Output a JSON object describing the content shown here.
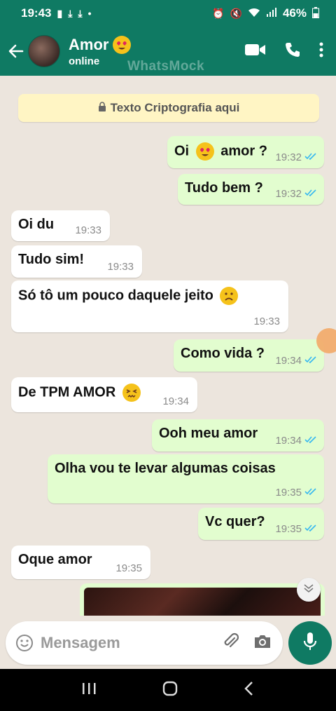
{
  "status_bar": {
    "time": "19:43",
    "battery": "46%"
  },
  "header": {
    "contact_name": "Amor",
    "contact_status": "online",
    "watermark": "WhatsMock"
  },
  "chat": {
    "notice": "Texto Criptografia aqui",
    "messages": [
      {
        "dir": "out",
        "text": "Oi",
        "emoji_after": true,
        "text2": "amor ?",
        "time": "19:32"
      },
      {
        "dir": "out",
        "text": "Tudo bem ?",
        "time": "19:32"
      },
      {
        "dir": "in",
        "text": "Oi du",
        "time": "19:33"
      },
      {
        "dir": "in",
        "text": "Tudo sim!",
        "time": "19:33"
      },
      {
        "dir": "in",
        "text": "Só tô um pouco daquele jeito",
        "time": "19:33"
      },
      {
        "dir": "out",
        "text": "Como vida ?",
        "time": "19:34"
      },
      {
        "dir": "in",
        "text": "De TPM AMOR",
        "time": "19:34"
      },
      {
        "dir": "out",
        "text": "Ooh meu amor",
        "time": "19:34"
      },
      {
        "dir": "out",
        "text": "Olha vou te levar algumas coisas",
        "time": "19:35"
      },
      {
        "dir": "out",
        "text": "Vc quer?",
        "time": "19:35"
      },
      {
        "dir": "in",
        "text": "Oque amor",
        "time": "19:35"
      }
    ]
  },
  "input": {
    "placeholder": "Mensagem"
  },
  "colors": {
    "primary": "#0f7a63",
    "outgoing_bubble": "#e2fdcf",
    "incoming_bubble": "#ffffff",
    "chat_bg": "#ece5dd",
    "notice_bg": "#fff5c4",
    "read_tick": "#34b7f1"
  }
}
